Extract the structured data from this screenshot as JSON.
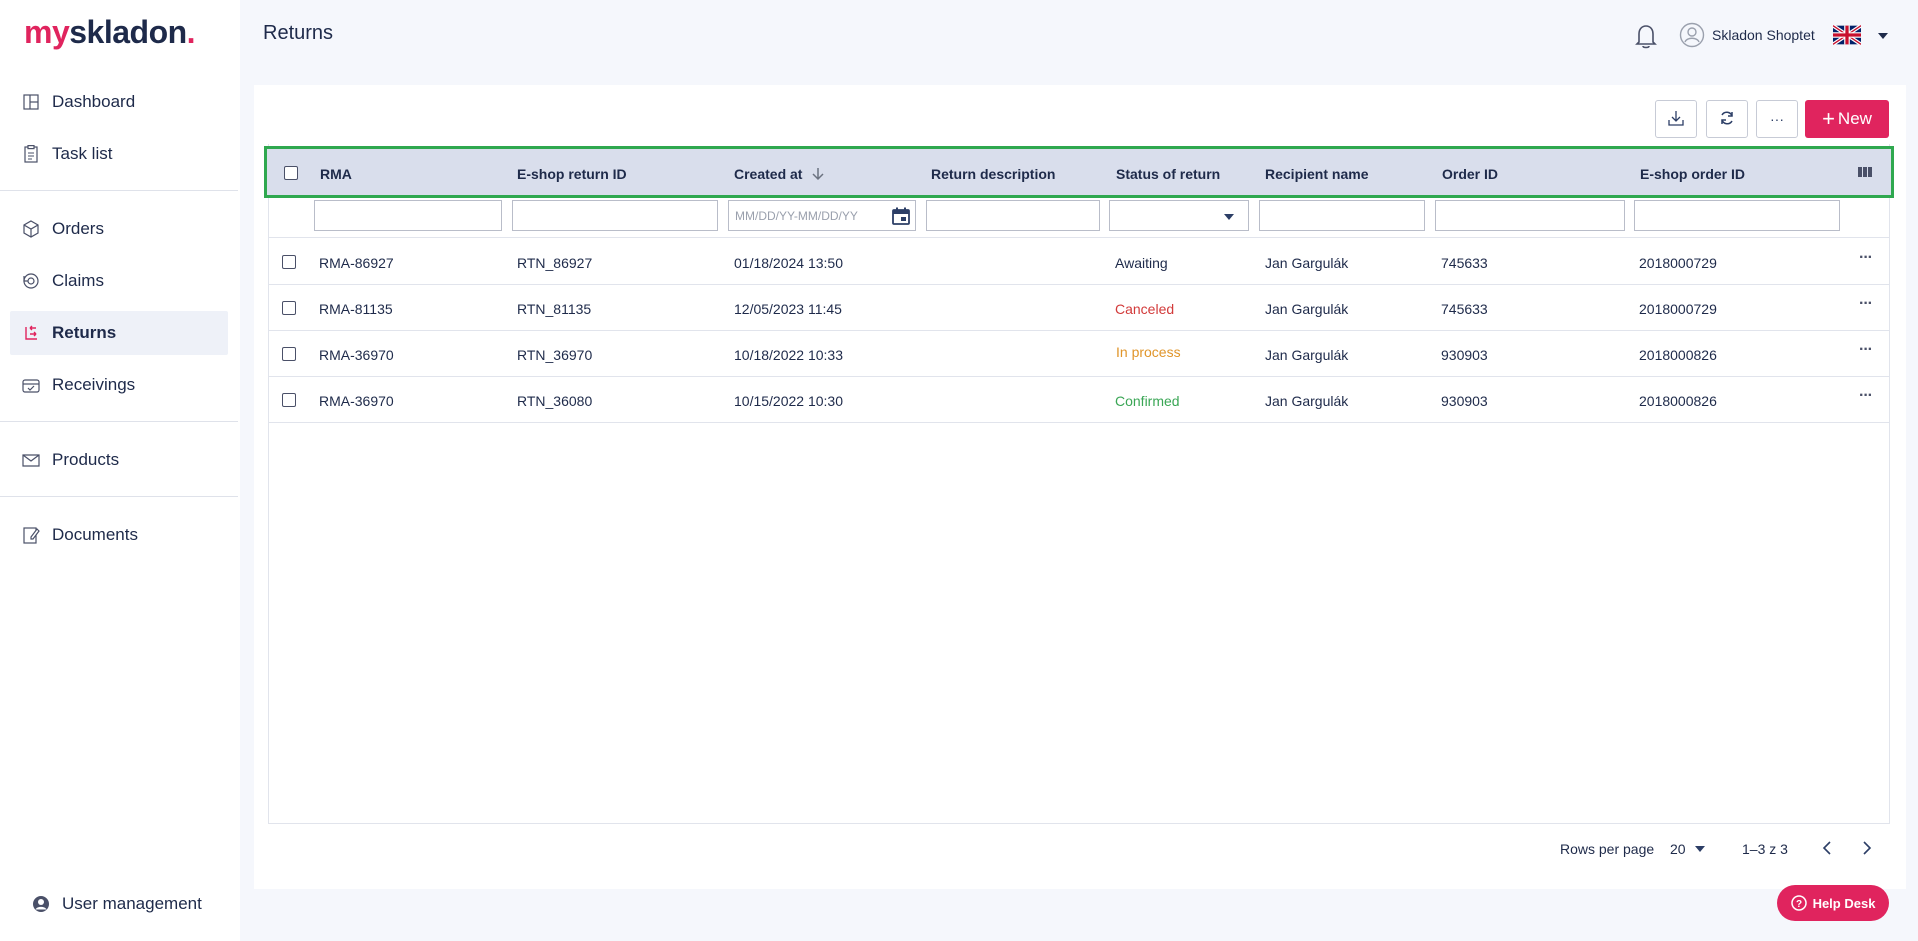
{
  "brand": {
    "part1": "my",
    "part2": "skladon",
    "part3": "."
  },
  "header": {
    "title": "Returns",
    "user_name": "Skladon Shoptet"
  },
  "sidebar": {
    "items": [
      {
        "label": "Dashboard",
        "icon": "dashboard-icon"
      },
      {
        "label": "Task list",
        "icon": "clipboard-icon"
      },
      {
        "label": "Orders",
        "icon": "box-icon"
      },
      {
        "label": "Claims",
        "icon": "claims-icon"
      },
      {
        "label": "Returns",
        "icon": "return-icon"
      },
      {
        "label": "Receivings",
        "icon": "receiving-icon"
      },
      {
        "label": "Products",
        "icon": "inbox-icon"
      },
      {
        "label": "Documents",
        "icon": "document-edit-icon"
      }
    ],
    "user_management": "User management"
  },
  "toolbar": {
    "more_label": "···",
    "new_label": "New"
  },
  "table": {
    "columns": [
      "RMA",
      "E-shop return ID",
      "Created at",
      "Return description",
      "Status of return",
      "Recipient name",
      "Order ID",
      "E-shop order ID"
    ],
    "date_placeholder": "MM/DD/YY-MM/DD/YY",
    "rows": [
      {
        "rma": "RMA-86927",
        "eshop_return_id": "RTN_86927",
        "created_at": "01/18/2024 13:50",
        "description": "",
        "status": "Awaiting",
        "recipient": "Jan Gargulák",
        "order_id": "745633",
        "eshop_order_id": "2018000729"
      },
      {
        "rma": "RMA-81135",
        "eshop_return_id": "RTN_81135",
        "created_at": "12/05/2023 11:45",
        "description": "",
        "status": "Canceled",
        "recipient": "Jan Gargulák",
        "order_id": "745633",
        "eshop_order_id": "2018000729"
      },
      {
        "rma": "RMA-36970",
        "eshop_return_id": "RTN_36970",
        "created_at": "10/18/2022 10:33",
        "description": "",
        "status": "In process",
        "recipient": "Jan Gargulák",
        "order_id": "930903",
        "eshop_order_id": "2018000826"
      },
      {
        "rma": "RMA-36970",
        "eshop_return_id": "RTN_36080",
        "created_at": "10/15/2022 10:30",
        "description": "",
        "status": "Confirmed",
        "recipient": "Jan Gargulák",
        "order_id": "930903",
        "eshop_order_id": "2018000826"
      }
    ]
  },
  "status_colors": {
    "Awaiting": "#1e2a4a",
    "Canceled": "#d23a3a",
    "In process": "#e0952a",
    "Confirmed": "#3aa655"
  },
  "colors": {
    "accent": "#e0245e",
    "highlight_border": "#2fa84f",
    "header_bg": "#d9deec"
  },
  "pagination": {
    "rows_per_page_label": "Rows per page",
    "rows_per_page": "20",
    "range": "1–3 z 3"
  },
  "help_desk": "Help Desk"
}
